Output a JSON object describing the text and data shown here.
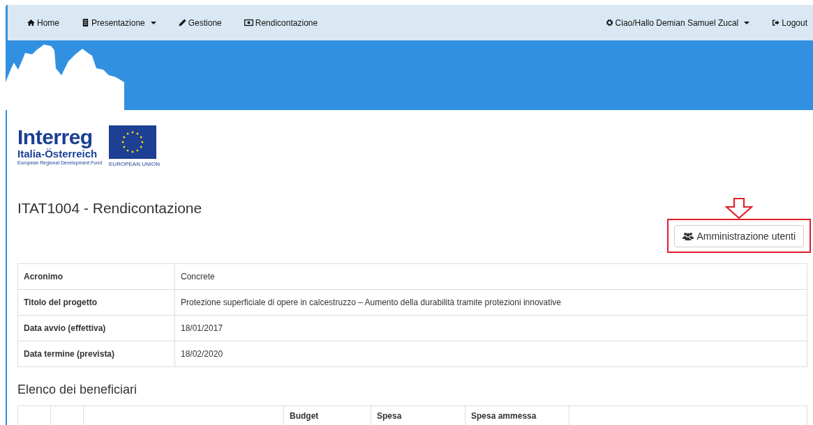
{
  "navbar": {
    "left": [
      {
        "label": "Home",
        "kind": "home",
        "dropdown": false
      },
      {
        "label": "Presentazione",
        "kind": "document",
        "dropdown": true
      },
      {
        "label": "Gestione",
        "kind": "edit",
        "dropdown": false
      },
      {
        "label": "Rendicontazione",
        "kind": "money",
        "dropdown": false
      }
    ],
    "right": [
      {
        "label": "Ciao/Hallo Demian Samuel Zucal",
        "kind": "settings",
        "dropdown": true
      },
      {
        "label": "Logout",
        "kind": "logout",
        "dropdown": false
      }
    ]
  },
  "logo": {
    "name": "Interreg",
    "region": "Italia-Österreich",
    "fund": "European Regional Development Fund",
    "eu": "EUROPEAN UNION"
  },
  "page_title": "ITAT1004 - Rendicontazione",
  "admin_button": "Amministrazione utenti",
  "details": [
    {
      "label": "Acronimo",
      "value": "Concrete"
    },
    {
      "label": "Titolo del progetto",
      "value": "Protezione superficiale di opere in calcestruzzo – Aumento della durabilità tramite protezioni innovative"
    },
    {
      "label": "Data avvio (effettiva)",
      "value": "18/01/2017"
    },
    {
      "label": "Data termine (prevista)",
      "value": "18/02/2020"
    }
  ],
  "beneficiaries": {
    "heading": "Elenco dei beneficiari",
    "columns": [
      "",
      "",
      "",
      "Budget",
      "Spesa",
      "Spesa ammessa",
      ""
    ]
  }
}
